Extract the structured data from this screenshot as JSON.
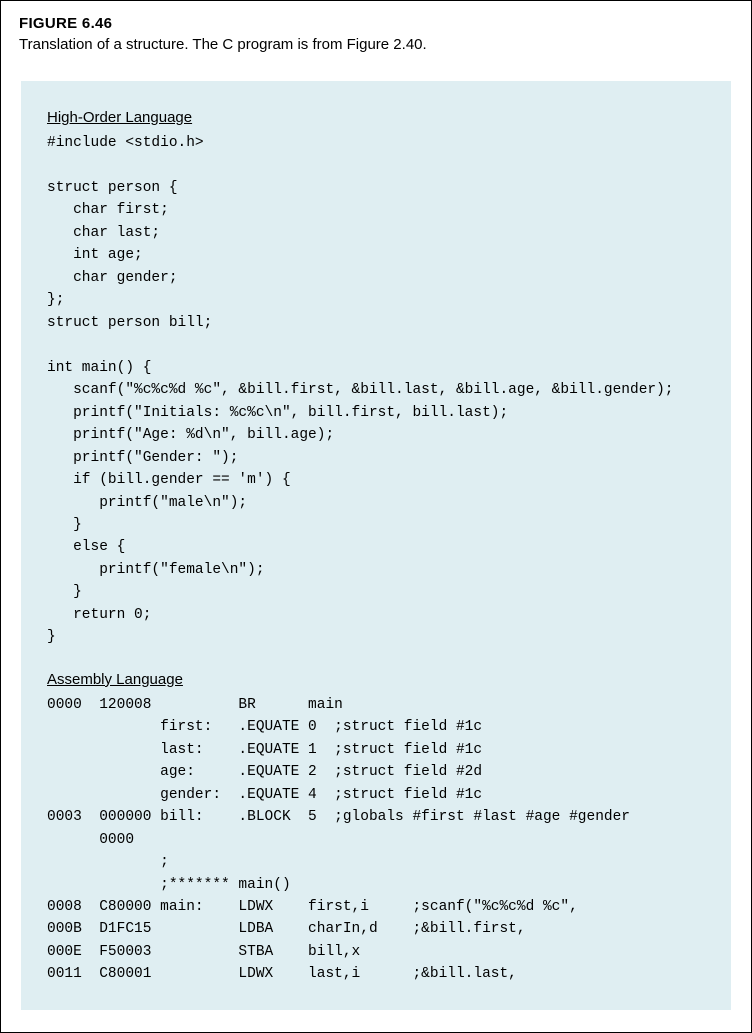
{
  "figure": {
    "number": "FIGURE 6.46",
    "caption": "Translation of a structure. The C program is from Figure 2.40."
  },
  "hol": {
    "title": "High-Order Language",
    "code": "#include <stdio.h>\n\nstruct person {\n   char first;\n   char last;\n   int age;\n   char gender;\n};\nstruct person bill;\n\nint main() {\n   scanf(\"%c%c%d %c\", &bill.first, &bill.last, &bill.age, &bill.gender);\n   printf(\"Initials: %c%c\\n\", bill.first, bill.last);\n   printf(\"Age: %d\\n\", bill.age);\n   printf(\"Gender: \");\n   if (bill.gender == 'm') {\n      printf(\"male\\n\");\n   }\n   else {\n      printf(\"female\\n\");\n   }\n   return 0;\n}"
  },
  "asm": {
    "title": "Assembly Language",
    "code": "0000  120008          BR      main\n             first:   .EQUATE 0  ;struct field #1c\n             last:    .EQUATE 1  ;struct field #1c\n             age:     .EQUATE 2  ;struct field #2d\n             gender:  .EQUATE 4  ;struct field #1c\n0003  000000 bill:    .BLOCK  5  ;globals #first #last #age #gender\n      0000\n             ;\n             ;******* main()\n0008  C80000 main:    LDWX    first,i     ;scanf(\"%c%c%d %c\",\n000B  D1FC15          LDBA    charIn,d    ;&bill.first,\n000E  F50003          STBA    bill,x\n0011  C80001          LDWX    last,i      ;&bill.last,"
  }
}
